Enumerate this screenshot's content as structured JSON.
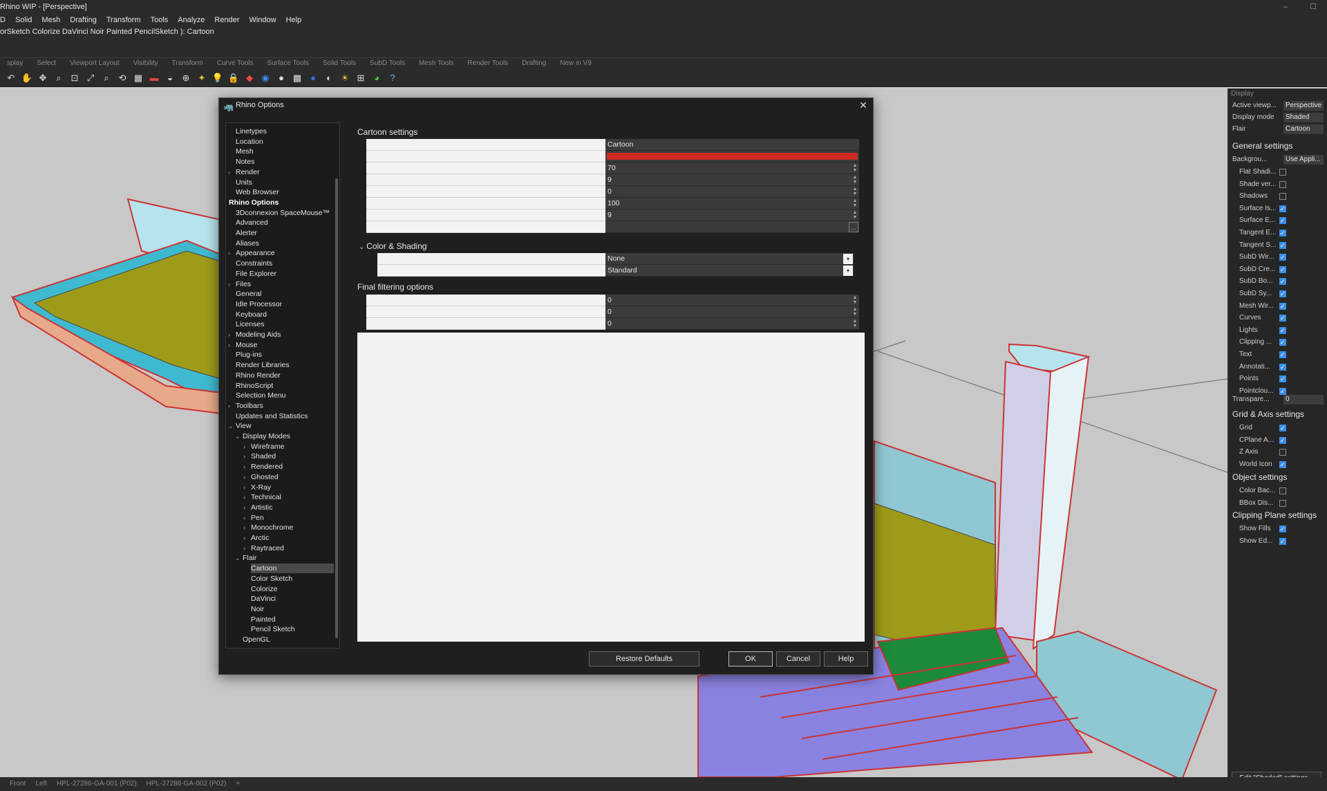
{
  "window": {
    "title": "Rhino WIP - [Perspective]",
    "controls": [
      "–",
      "☐"
    ]
  },
  "menu": [
    "D",
    "Solid",
    "Mesh",
    "Drafting",
    "Transform",
    "Tools",
    "Analyze",
    "Render",
    "Window",
    "Help"
  ],
  "command_line": "orSketch Colorize DaVinci Noir Painted PencilSketch ): Cartoon",
  "toolbar_tabs": [
    "splay",
    "Select",
    "Viewport Layout",
    "Visibility",
    "Transform",
    "Curve Tools",
    "Surface Tools",
    "Solid Tools",
    "SubD Tools",
    "Mesh Tools",
    "Render Tools",
    "Drafting",
    "New in V9"
  ],
  "viewport_tabs": [
    "Front",
    "Left",
    "HPL-27286-GA-001 (P02)",
    "HPL-27286-GA-002 (P02)",
    "+"
  ],
  "right_panel": {
    "header": "Display",
    "props": [
      {
        "label": "Active viewp...",
        "value": "Perspective"
      },
      {
        "label": "Display mode",
        "value": "Shaded"
      },
      {
        "label": "Flair",
        "value": "Cartoon"
      }
    ],
    "general_title": "General settings",
    "background": {
      "label": "Backgrou...",
      "value": "Use Appli..."
    },
    "general": [
      {
        "label": "Flat Shadi...",
        "checked": false
      },
      {
        "label": "Shade ver...",
        "checked": false
      },
      {
        "label": "Shadows",
        "checked": false
      },
      {
        "label": "Surface Is...",
        "checked": true
      },
      {
        "label": "Surface E...",
        "checked": true
      },
      {
        "label": "Tangent E...",
        "checked": true
      },
      {
        "label": "Tangent S...",
        "checked": true
      },
      {
        "label": "SubD Wir...",
        "checked": true
      },
      {
        "label": "SubD Cre...",
        "checked": true
      },
      {
        "label": "SubD Bo...",
        "checked": true
      },
      {
        "label": "SubD Sy...",
        "checked": true
      },
      {
        "label": "Mesh Wir...",
        "checked": true
      },
      {
        "label": "Curves",
        "checked": true
      },
      {
        "label": "Lights",
        "checked": true
      },
      {
        "label": "Clipping ...",
        "checked": true
      },
      {
        "label": "Text",
        "checked": true
      },
      {
        "label": "Annotati...",
        "checked": true
      },
      {
        "label": "Points",
        "checked": true
      },
      {
        "label": "Pointclou...",
        "checked": true
      }
    ],
    "transparency": {
      "label": "Transpare...",
      "value": "0"
    },
    "grid_title": "Grid & Axis settings",
    "grid": [
      {
        "label": "Grid",
        "checked": true
      },
      {
        "label": "CPlane A...",
        "checked": true
      },
      {
        "label": "Z Axis",
        "checked": false
      },
      {
        "label": "World Icon",
        "checked": true
      }
    ],
    "object_title": "Object settings",
    "object": [
      {
        "label": "Color Bac...",
        "checked": false
      },
      {
        "label": "BBox Dis...",
        "checked": false
      }
    ],
    "clipping_title": "Clipping Plane settings",
    "clipping": [
      {
        "label": "Show Fills",
        "checked": true
      },
      {
        "label": "Show Ed...",
        "checked": true
      }
    ],
    "edit_button": "Edit \"Shaded\" settings..."
  },
  "dialog": {
    "title": "Rhino Options",
    "tree": [
      {
        "label": "Linetypes",
        "indent": 1,
        "chev": ""
      },
      {
        "label": "Location",
        "indent": 1,
        "chev": ""
      },
      {
        "label": "Mesh",
        "indent": 1,
        "chev": ""
      },
      {
        "label": "Notes",
        "indent": 1,
        "chev": ""
      },
      {
        "label": "Render",
        "indent": 1,
        "chev": "›"
      },
      {
        "label": "Units",
        "indent": 1,
        "chev": ""
      },
      {
        "label": "Web Browser",
        "indent": 1,
        "chev": ""
      },
      {
        "label": "Rhino Options",
        "indent": 0,
        "chev": "",
        "bold": true
      },
      {
        "label": "3Dconnexion SpaceMouse™",
        "indent": 1,
        "chev": ""
      },
      {
        "label": "Advanced",
        "indent": 1,
        "chev": ""
      },
      {
        "label": "Alerter",
        "indent": 1,
        "chev": ""
      },
      {
        "label": "Aliases",
        "indent": 1,
        "chev": ""
      },
      {
        "label": "Appearance",
        "indent": 1,
        "chev": "›"
      },
      {
        "label": "Constraints",
        "indent": 1,
        "chev": ""
      },
      {
        "label": "File Explorer",
        "indent": 1,
        "chev": ""
      },
      {
        "label": "Files",
        "indent": 1,
        "chev": "›"
      },
      {
        "label": "General",
        "indent": 1,
        "chev": ""
      },
      {
        "label": "Idle Processor",
        "indent": 1,
        "chev": ""
      },
      {
        "label": "Keyboard",
        "indent": 1,
        "chev": ""
      },
      {
        "label": "Licenses",
        "indent": 1,
        "chev": ""
      },
      {
        "label": "Modeling Aids",
        "indent": 1,
        "chev": "›"
      },
      {
        "label": "Mouse",
        "indent": 1,
        "chev": "›"
      },
      {
        "label": "Plug-ins",
        "indent": 1,
        "chev": ""
      },
      {
        "label": "Render Libraries",
        "indent": 1,
        "chev": ""
      },
      {
        "label": "Rhino Render",
        "indent": 1,
        "chev": ""
      },
      {
        "label": "RhinoScript",
        "indent": 1,
        "chev": ""
      },
      {
        "label": "Selection Menu",
        "indent": 1,
        "chev": ""
      },
      {
        "label": "Toolbars",
        "indent": 1,
        "chev": "›"
      },
      {
        "label": "Updates and Statistics",
        "indent": 1,
        "chev": ""
      },
      {
        "label": "View",
        "indent": 1,
        "chev": "⌄"
      },
      {
        "label": "Display Modes",
        "indent": 2,
        "chev": "⌄"
      },
      {
        "label": "Wireframe",
        "indent": 3,
        "chev": "›"
      },
      {
        "label": "Shaded",
        "indent": 3,
        "chev": "›"
      },
      {
        "label": "Rendered",
        "indent": 3,
        "chev": "›"
      },
      {
        "label": "Ghosted",
        "indent": 3,
        "chev": "›"
      },
      {
        "label": "X-Ray",
        "indent": 3,
        "chev": "›"
      },
      {
        "label": "Technical",
        "indent": 3,
        "chev": "›"
      },
      {
        "label": "Artistic",
        "indent": 3,
        "chev": "›"
      },
      {
        "label": "Pen",
        "indent": 3,
        "chev": "›"
      },
      {
        "label": "Monochrome",
        "indent": 3,
        "chev": "›"
      },
      {
        "label": "Arctic",
        "indent": 3,
        "chev": "›"
      },
      {
        "label": "Raytraced",
        "indent": 3,
        "chev": "›"
      },
      {
        "label": "Flair",
        "indent": 2,
        "chev": "⌄"
      },
      {
        "label": "Cartoon",
        "indent": 3,
        "chev": "",
        "selected": true
      },
      {
        "label": "Color Sketch",
        "indent": 3,
        "chev": ""
      },
      {
        "label": "Colorize",
        "indent": 3,
        "chev": ""
      },
      {
        "label": "DaVinci",
        "indent": 3,
        "chev": ""
      },
      {
        "label": "Noir",
        "indent": 3,
        "chev": ""
      },
      {
        "label": "Painted",
        "indent": 3,
        "chev": ""
      },
      {
        "label": "Pencil Sketch",
        "indent": 3,
        "chev": ""
      },
      {
        "label": "OpenGL",
        "indent": 2,
        "chev": ""
      }
    ],
    "cartoon_title": "Cartoon settings",
    "cartoon_rows": [
      {
        "value": "Cartoon",
        "kind": "text"
      },
      {
        "value": "",
        "kind": "color",
        "color": "#cc2a22"
      },
      {
        "value": "70",
        "kind": "spin"
      },
      {
        "value": "9",
        "kind": "spin"
      },
      {
        "value": "0",
        "kind": "spin"
      },
      {
        "value": "100",
        "kind": "spin"
      },
      {
        "value": "9",
        "kind": "spin"
      },
      {
        "value": "",
        "kind": "ellipsis"
      }
    ],
    "color_title": "Color & Shading",
    "color_rows": [
      {
        "value": "None",
        "kind": "dropdown"
      },
      {
        "value": "Standard",
        "kind": "dropdown"
      }
    ],
    "final_title": "Final filtering options",
    "final_rows": [
      {
        "value": "0",
        "kind": "spin"
      },
      {
        "value": "0",
        "kind": "spin"
      },
      {
        "value": "0",
        "kind": "spin"
      }
    ],
    "buttons": {
      "restore": "Restore Defaults",
      "ok": "OK",
      "cancel": "Cancel",
      "help": "Help"
    }
  }
}
